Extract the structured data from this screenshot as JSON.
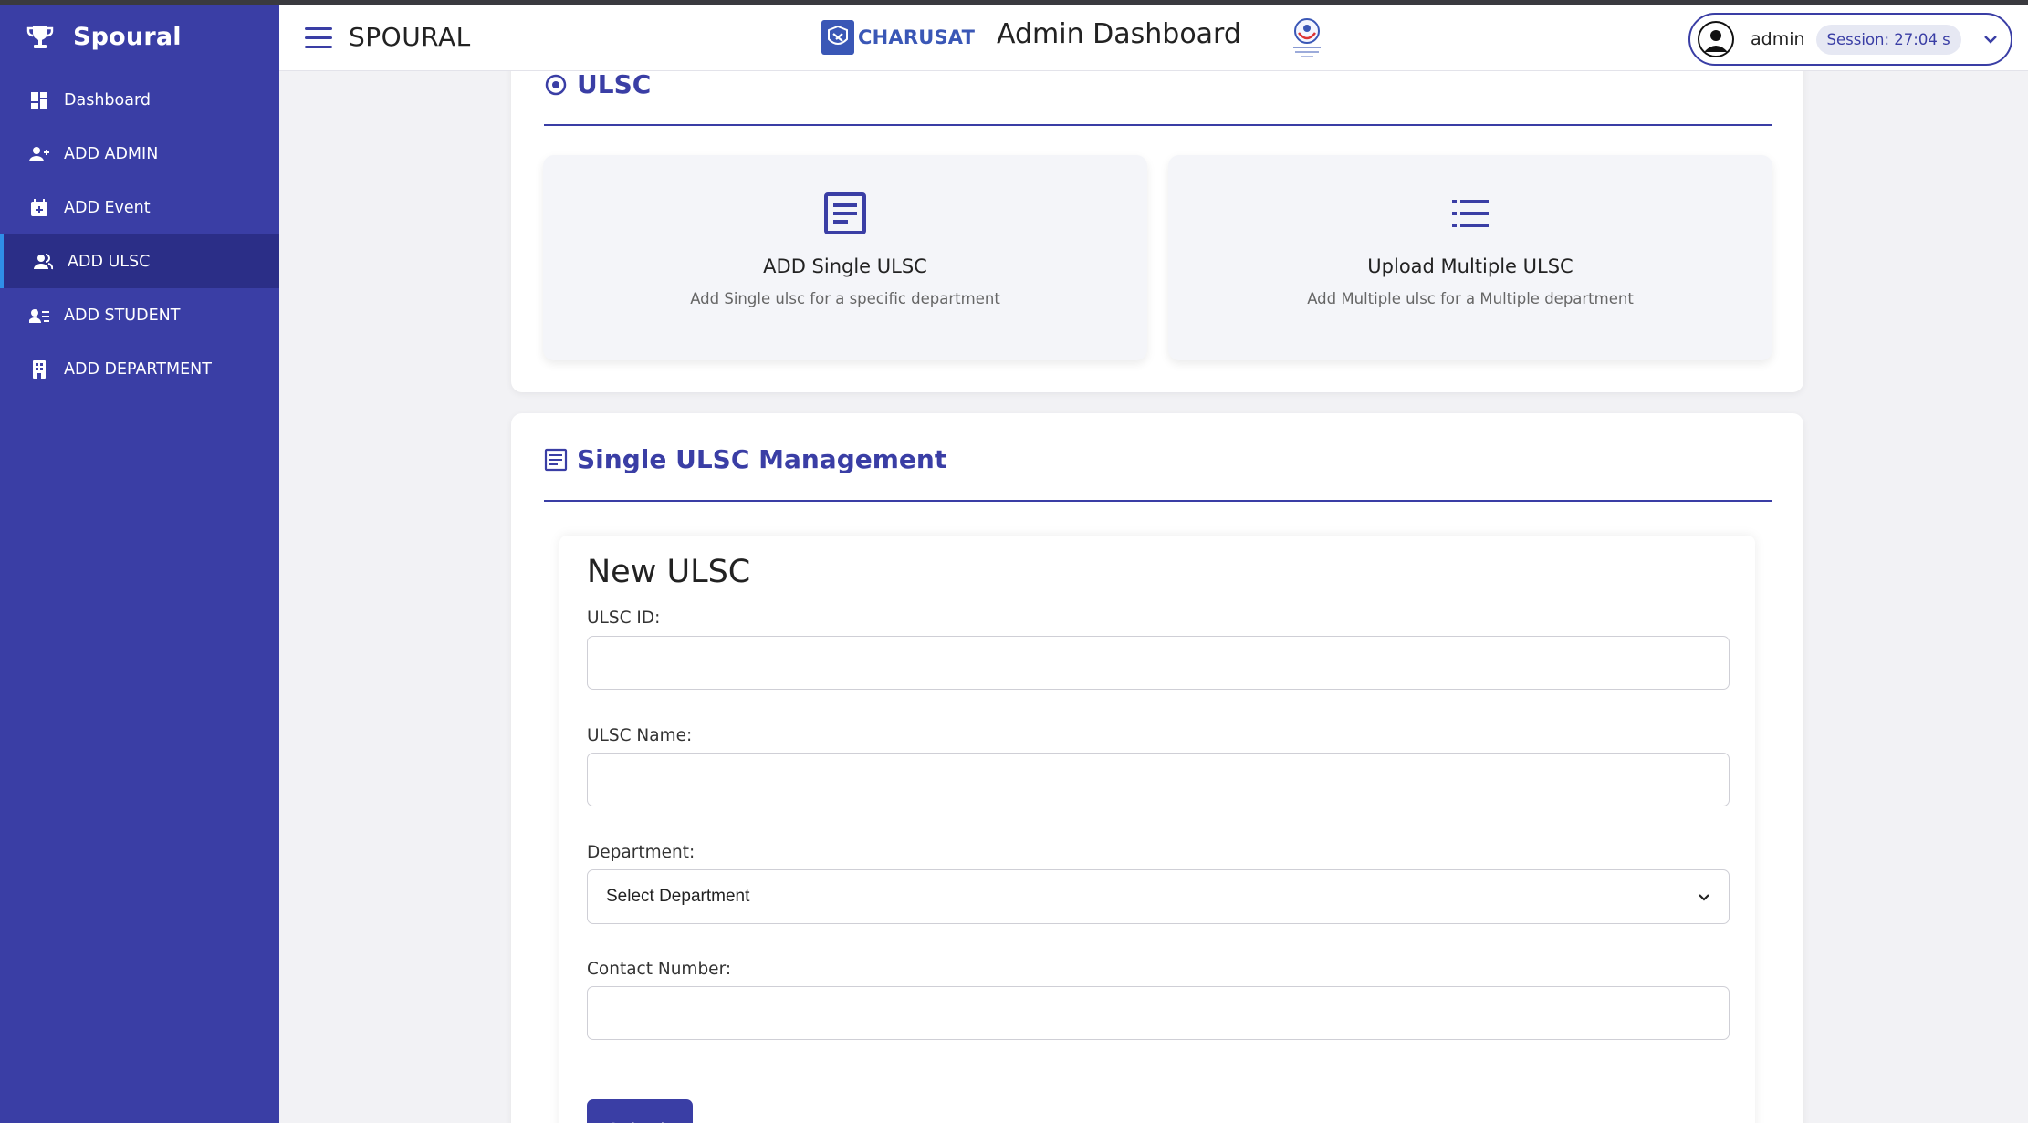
{
  "brand": {
    "name": "Spoural",
    "icon": "trophy-icon"
  },
  "sidebar": {
    "items": [
      {
        "label": "Dashboard",
        "icon": "dashboard-icon"
      },
      {
        "label": "ADD ADMIN",
        "icon": "add-user-icon"
      },
      {
        "label": "ADD Event",
        "icon": "calendar-add-icon"
      },
      {
        "label": "ADD ULSC",
        "icon": "users-icon",
        "active": true
      },
      {
        "label": "ADD STUDENT",
        "icon": "student-list-icon"
      },
      {
        "label": "ADD DEPARTMENT",
        "icon": "building-icon"
      }
    ]
  },
  "header": {
    "app_name": "SPOURAL",
    "logo_text": "CHARUSAT",
    "title": "Admin Dashboard",
    "user": "admin",
    "session": "Session: 27:04 s"
  },
  "ulsc_section": {
    "title": "ULSC",
    "options": [
      {
        "title": "ADD Single ULSC",
        "desc": "Add Single ulsc for a specific department",
        "icon": "document-icon"
      },
      {
        "title": "Upload Multiple ULSC",
        "desc": "Add Multiple ulsc for a Multiple department",
        "icon": "list-icon"
      }
    ]
  },
  "single_section": {
    "title": "Single ULSC Management",
    "form": {
      "title": "New ULSC",
      "fields": {
        "ulsc_id": {
          "label": "ULSC ID:",
          "value": ""
        },
        "ulsc_name": {
          "label": "ULSC Name:",
          "value": ""
        },
        "department": {
          "label": "Department:",
          "value": "Select Department"
        },
        "contact": {
          "label": "Contact Number:",
          "value": ""
        }
      },
      "submit": "Submit"
    }
  },
  "colors": {
    "primary": "#3a3ea5",
    "sidebar_active": "#2b2e87",
    "active_border": "#2f8fe8",
    "background": "#f2f2f5"
  }
}
